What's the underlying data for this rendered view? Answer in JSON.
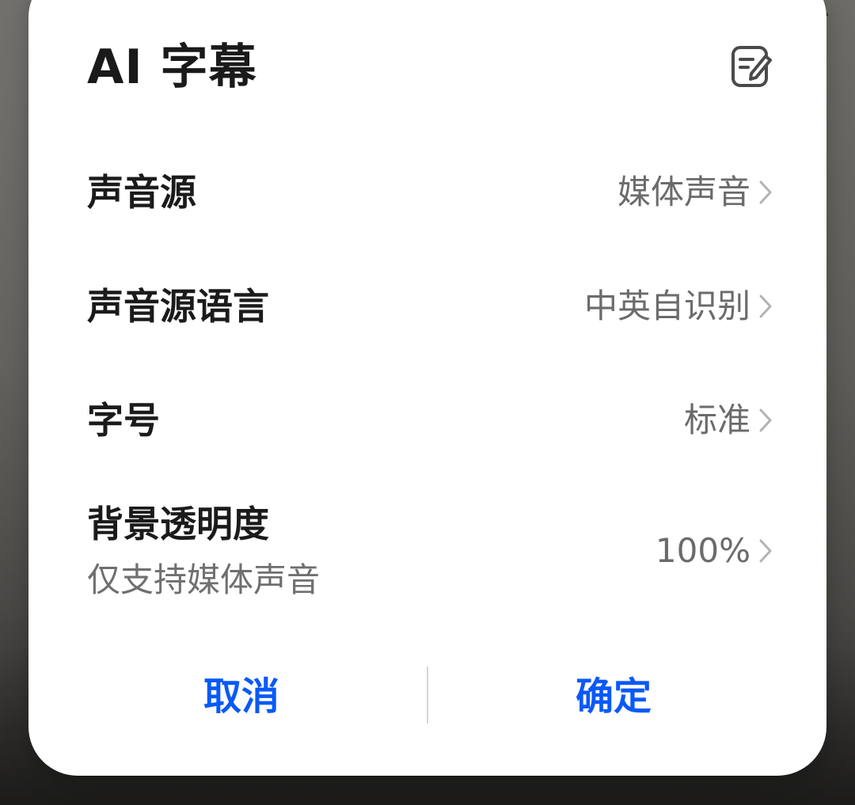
{
  "dialog": {
    "title": "AI 字幕",
    "header_icon": "edit-icon"
  },
  "settings": [
    {
      "label": "声音源",
      "value": "媒体声音",
      "icon": "chevron-right-icon"
    },
    {
      "label": "声音源语言",
      "value": "中英自识别",
      "icon": "chevron-right-icon"
    },
    {
      "label": "字号",
      "value": "标准",
      "icon": "chevron-right-icon"
    },
    {
      "label": "背景透明度",
      "sublabel": "仅支持媒体声音",
      "value": "100%",
      "icon": "chevron-right-icon"
    }
  ],
  "footer": {
    "cancel_label": "取消",
    "confirm_label": "确定"
  },
  "colors": {
    "accent": "#0a59f7",
    "title_text": "#1a1a1a",
    "secondary_text": "#6b6b6b",
    "dialog_background": "#ffffff"
  }
}
